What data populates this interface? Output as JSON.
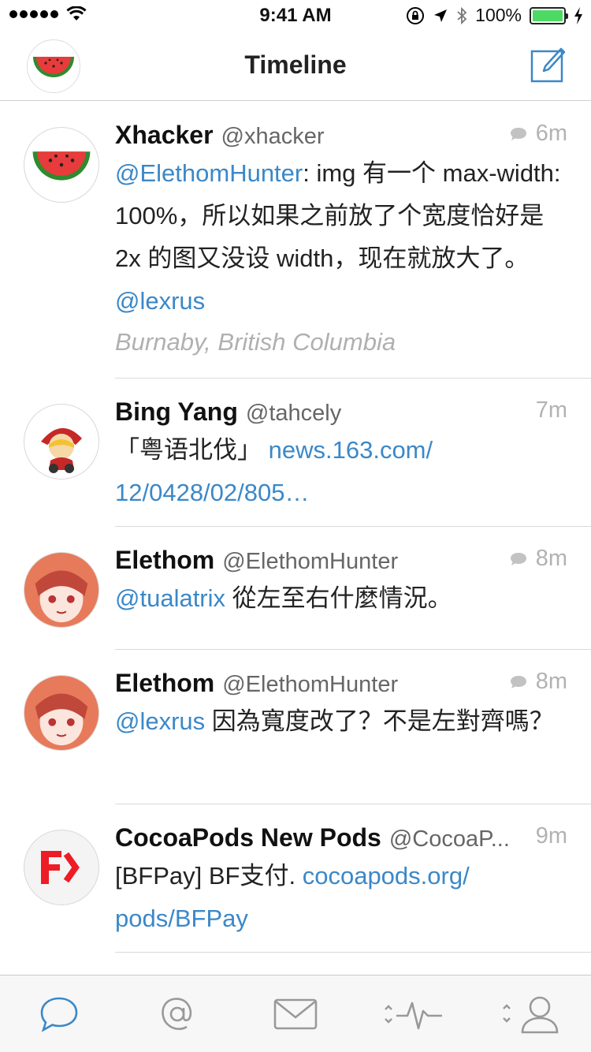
{
  "status_bar": {
    "time": "9:41 AM",
    "battery": "100%"
  },
  "nav": {
    "title": "Timeline"
  },
  "tweets": [
    {
      "name": "Xhacker",
      "handle": "@xhacker",
      "time": "6m",
      "has_reply": true,
      "mention": "@ElethomHunter",
      "text": ": img 有一个 max-width: 100%，所以如果之前放了个宽度恰好是 2x 的图又没设 width，现在就放大了。",
      "trail_link": "@lexrus",
      "location": "Burnaby, British Columbia"
    },
    {
      "name": "Bing Yang",
      "handle": "@tahcely",
      "time": "7m",
      "text": "「粤语北伐」",
      "link": "news.163.com/ 12/0428/02/805…"
    },
    {
      "name": "Elethom",
      "handle": "@ElethomHunter",
      "time": "8m",
      "has_reply": true,
      "mention": "@tualatrix",
      "text": " 從左至右什麼情況。"
    },
    {
      "name": "Elethom",
      "handle": "@ElethomHunter",
      "time": "8m",
      "has_reply": true,
      "mention": "@lexrus",
      "text": " 因為寬度改了？不是左對齊嗎？"
    },
    {
      "name": "CocoaPods New Pods",
      "handle": "@CocoaP...",
      "time": "9m",
      "text": "[BFPay] BF支付. ",
      "link": "cocoapods.org/ pods/BFPay"
    }
  ],
  "tabs": [
    "timeline",
    "mentions",
    "messages",
    "activity",
    "profile"
  ],
  "colors": {
    "accent": "#3b88c8",
    "battery": "#4cd964"
  }
}
